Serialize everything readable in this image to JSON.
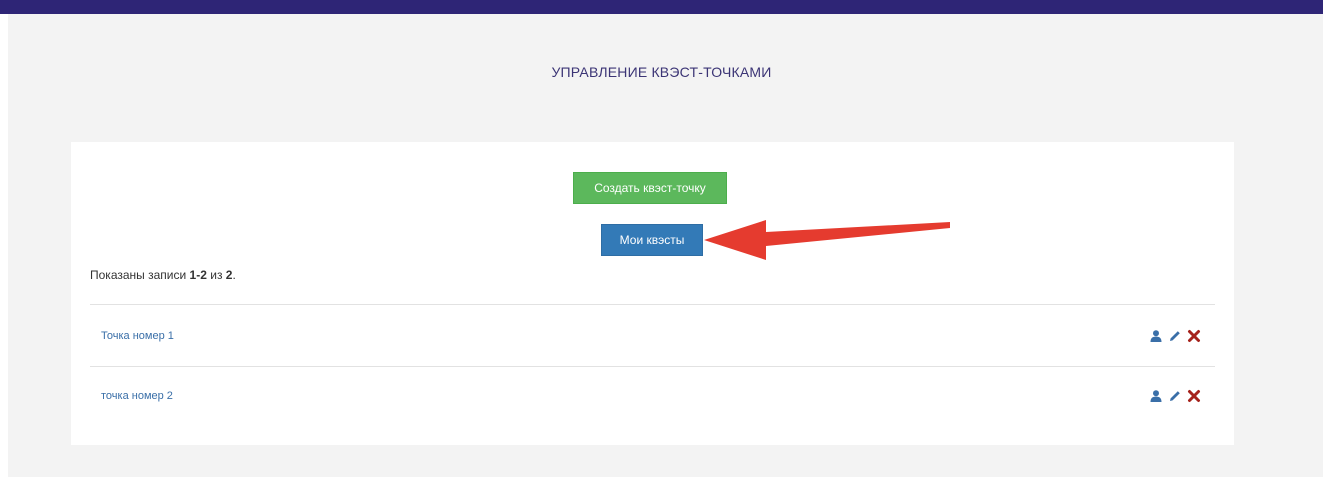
{
  "header": {
    "bar_color": "#2e2576"
  },
  "page": {
    "title": "УПРАВЛЕНИЕ КВЭСТ-ТОЧКАМИ"
  },
  "buttons": {
    "create_label": "Создать квэст-точку",
    "create_color": "#5cb85c",
    "my_quests_label": "Мои квэсты",
    "my_quests_color": "#337ab7"
  },
  "summary": {
    "prefix": "Показаны записи",
    "range": "1-2",
    "of": "из",
    "total": "2",
    "suffix": "."
  },
  "rows": [
    {
      "label": "Точка номер 1",
      "actions": [
        "user-icon",
        "pencil-icon",
        "delete-icon"
      ]
    },
    {
      "label": "точка номер 2",
      "actions": [
        "user-icon",
        "pencil-icon",
        "delete-icon"
      ]
    }
  ],
  "annotation": {
    "arrow_color": "#e53b2f",
    "points_to": "my-quests-button"
  }
}
